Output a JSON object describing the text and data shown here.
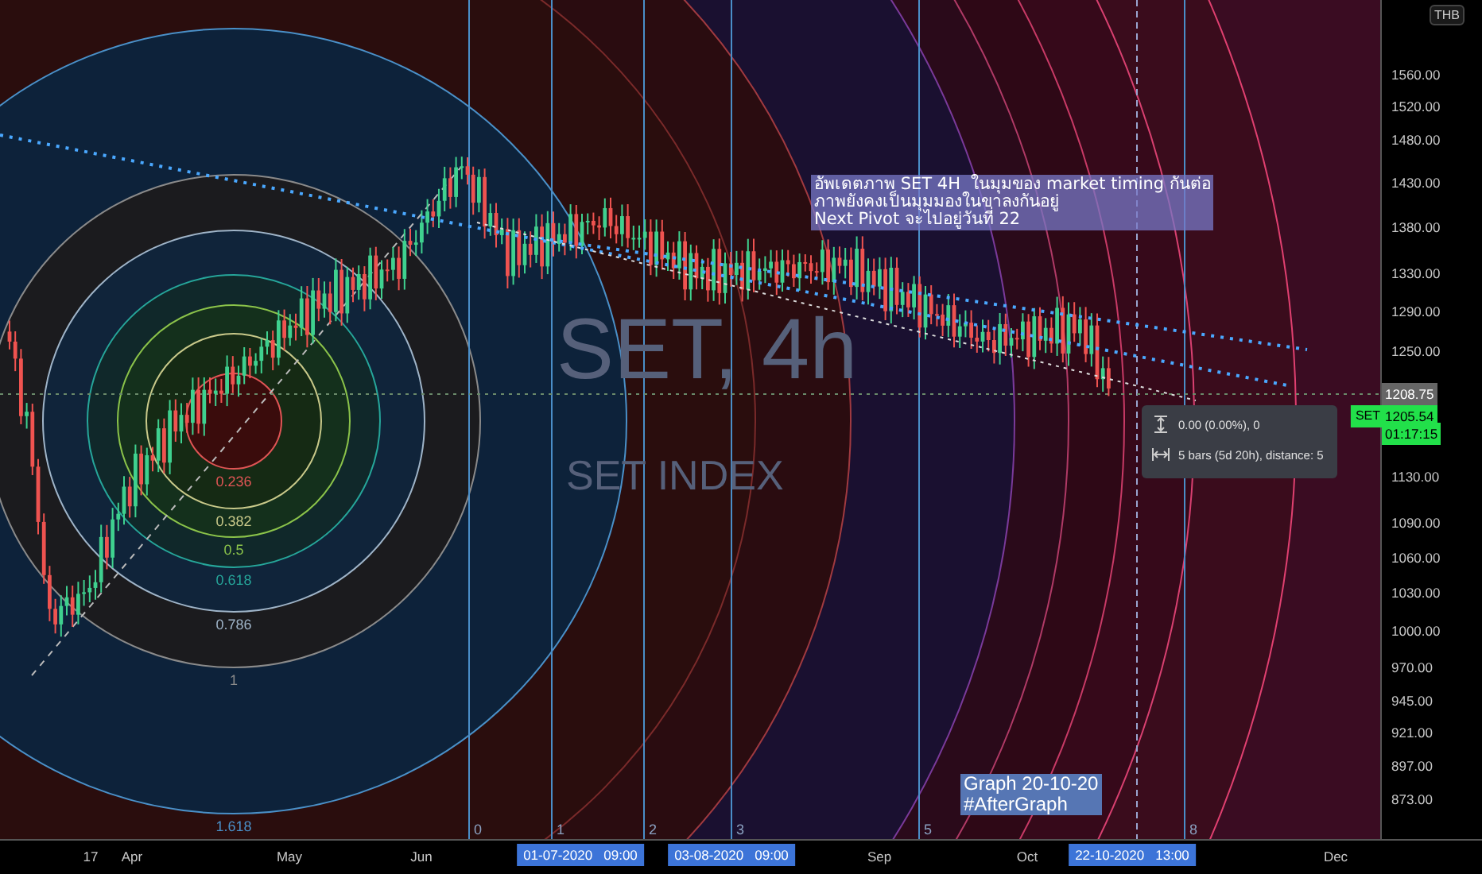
{
  "chart": {
    "symbol_watermark": "SET, 4h",
    "name_watermark": "SET INDEX",
    "fib_levels": [
      "0.236",
      "0.382",
      "0.5",
      "0.618",
      "0.786",
      "1",
      "1.618"
    ],
    "cycle_numbers": [
      "0",
      "1",
      "2",
      "3",
      "5",
      "8"
    ],
    "notes": [
      {
        "kind": "outlook",
        "lines": [
          "อัพเดตภาพ SET 4H  ในมุมของ market timing กันต่อ",
          "ภาพยังคงเป็นมุมมองในขาลงกันอยู่",
          "Next Pivot จะไปอยู่วันที่ 22"
        ]
      },
      {
        "kind": "signature",
        "lines": [
          "Graph 20-10-20",
          "#AfterGraph"
        ]
      }
    ]
  },
  "tooltip": {
    "rows": [
      {
        "kind": "price_range",
        "text": "0.00 (0.00%), 0"
      },
      {
        "kind": "date_range",
        "text": "5 bars (5d 20h), distance: 5"
      }
    ]
  },
  "price_axis": {
    "currency": "THB",
    "labels": [
      {
        "kind": "tick",
        "text": "1560.00"
      },
      {
        "kind": "tick",
        "text": "1520.00"
      },
      {
        "kind": "tick",
        "text": "1480.00"
      },
      {
        "kind": "tick",
        "text": "1430.00"
      },
      {
        "kind": "tick",
        "text": "1380.00"
      },
      {
        "kind": "tick",
        "text": "1330.00"
      },
      {
        "kind": "tick",
        "text": "1290.00"
      },
      {
        "kind": "tick",
        "text": "1250.00"
      },
      {
        "kind": "crosshair",
        "text": "1208.75"
      },
      {
        "kind": "current",
        "symbol": "SET",
        "text": "1205.54"
      },
      {
        "kind": "countdown",
        "text": "01:17:15"
      },
      {
        "kind": "tick",
        "text": "1130.00"
      },
      {
        "kind": "tick",
        "text": "1090.00"
      },
      {
        "kind": "tick",
        "text": "1060.00"
      },
      {
        "kind": "tick",
        "text": "1030.00"
      },
      {
        "kind": "tick",
        "text": "1000.00"
      },
      {
        "kind": "tick",
        "text": "970.00"
      },
      {
        "kind": "tick",
        "text": "945.00"
      },
      {
        "kind": "tick",
        "text": "921.00"
      },
      {
        "kind": "tick",
        "text": "897.00"
      },
      {
        "kind": "tick",
        "text": "873.00"
      }
    ]
  },
  "time_axis": {
    "labels": [
      {
        "kind": "tick",
        "text": "17"
      },
      {
        "kind": "tick",
        "text": "Apr"
      },
      {
        "kind": "tick",
        "text": "May"
      },
      {
        "kind": "tick",
        "text": "Jun"
      },
      {
        "kind": "marker",
        "text": "01-07-2020   09:00"
      },
      {
        "kind": "marker",
        "text": "03-08-2020   09:00"
      },
      {
        "kind": "tick",
        "text": "Sep"
      },
      {
        "kind": "tick",
        "text": "Oct"
      },
      {
        "kind": "marker",
        "text": "22-10-2020   13:00"
      },
      {
        "kind": "tick",
        "text": "Dec"
      }
    ]
  }
}
